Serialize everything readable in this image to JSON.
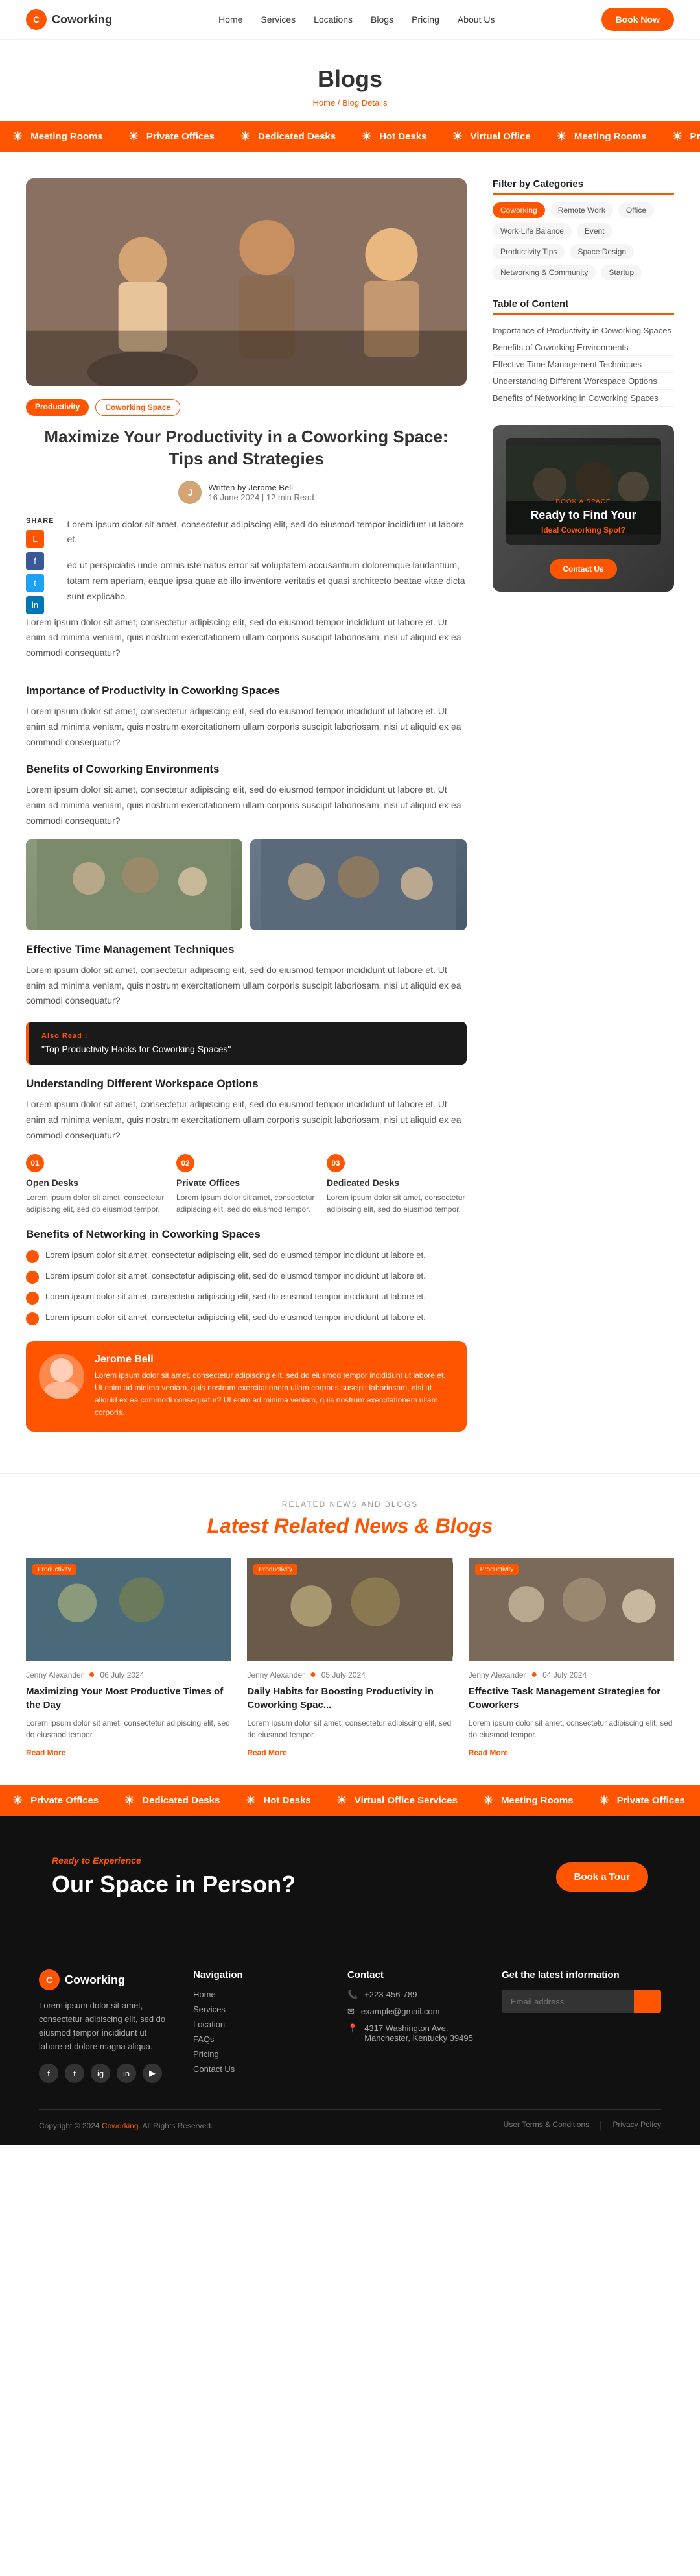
{
  "navbar": {
    "logo_text": "Coworking",
    "logo_icon": "C",
    "links": [
      "Home",
      "Services",
      "Locations",
      "Blogs",
      "Pricing",
      "About Us"
    ],
    "book_btn": "Book Now"
  },
  "page_header": {
    "title": "Blogs",
    "breadcrumb_home": "Home",
    "breadcrumb_sep": "/",
    "breadcrumb_current": "Blog Details"
  },
  "ticker": {
    "items": [
      "Meeting Rooms",
      "Private Offices",
      "Dedicated Desks",
      "Hot Desks",
      "Virtual Office",
      "Meeting Rooms",
      "Private Offices",
      "Dedicated Desks",
      "Hot Desks",
      "Virtual Office"
    ]
  },
  "article": {
    "tags": [
      "Productivity",
      "Coworking Space"
    ],
    "title": "Maximize Your Productivity in a Coworking Space: Tips and Strategies",
    "author_name": "Jerome Bell",
    "meta": "16 June 2024 | 12 min Read",
    "intro": "Lorem ipsum dolor sit amet, consectetur adipiscing elit, sed do eiusmod tempor incididunt ut labore et.",
    "intro_p2": "ed ut perspiciatis unde omnis iste natus error sit voluptatem accusantium doloremque laudantium, totam rem aperiam, eaque ipsa quae ab illo inventore veritatis et quasi architecto beatae vitae dicta sunt explicabo.",
    "intro_p3": "Lorem ipsum dolor sit amet, consectetur adipiscing elit, sed do eiusmod tempor incididunt ut labore et. Ut enim ad minima veniam, quis nostrum exercitationem ullam corporis suscipit laboriosam, nisi ut aliquid ex ea commodi consequatur?",
    "section1_title": "Importance of Productivity in Coworking Spaces",
    "section1_text": "Lorem ipsum dolor sit amet, consectetur adipiscing elit, sed do eiusmod tempor incididunt ut labore et. Ut enim ad minima veniam, quis nostrum exercitationem ullam corporis suscipit laboriosam, nisi ut aliquid ex ea commodi consequatur?",
    "section2_title": "Benefits of Coworking Environments",
    "section2_text": "Lorem ipsum dolor sit amet, consectetur adipiscing elit, sed do eiusmod tempor incididunt ut labore et. Ut enim ad minima veniam, quis nostrum exercitationem ullam corporis suscipit laboriosam, nisi ut aliquid ex ea commodi consequatur?",
    "section3_title": "Effective Time Management Techniques",
    "section3_text": "Lorem ipsum dolor sit amet, consectetur adipiscing elit, sed do eiusmod tempor incididunt ut labore et. Ut enim ad minima veniam, quis nostrum exercitationem ullam corporis suscipit laboriosam, nisi ut aliquid ex ea commodi consequatur?",
    "also_read_label": "Also Read :",
    "also_read_link": "\"Top Productivity Hacks for Coworking Spaces\"",
    "section4_title": "Understanding Different Workspace Options",
    "section4_text": "Lorem ipsum dolor sit amet, consectetur adipiscing elit, sed do eiusmod tempor incididunt ut labore et. Ut enim ad minima veniam, quis nostrum exercitationem ullam corporis suscipit laboriosam, nisi ut aliquid ex ea commodi consequatur?",
    "options": [
      {
        "num": "01",
        "title": "Open Desks",
        "text": "Lorem ipsum dolor sit amet, consectetur adipiscing elit, sed do eiusmod tempor."
      },
      {
        "num": "02",
        "title": "Private Offices",
        "text": "Lorem ipsum dolor sit amet, consectetur adipiscing elit, sed do eiusmod tempor."
      },
      {
        "num": "03",
        "title": "Dedicated Desks",
        "text": "Lorem ipsum dolor sit amet, consectetur adipiscing elit, sed do eiusmod tempor."
      }
    ],
    "section5_title": "Benefits of Networking in Coworking Spaces",
    "bullets": [
      "Lorem ipsum dolor sit amet, consectetur adipiscing elit, sed do eiusmod tempor incididunt ut labore et.",
      "Lorem ipsum dolor sit amet, consectetur adipiscing elit, sed do eiusmod tempor incididunt ut labore et.",
      "Lorem ipsum dolor sit amet, consectetur adipiscing elit, sed do eiusmod tempor incididunt ut labore et.",
      "Lorem ipsum dolor sit amet, consectetur adipiscing elit, sed do eiusmod tempor incididunt ut labore et."
    ],
    "bio_name": "Jerome Bell",
    "bio_text": "Lorem ipsum dolor sit amet, consectetur adipiscing elit, sed do eiusmod tempor incididunt ut labore et. Ut enim ad minima veniam, quis nostrum exercitationem ullam corporis suscipit laboriosam, nisi ut aliquid ex ea commodi consequatur? Ut enim ad minima veniam, quis nostrum exercitationem ullam corporis."
  },
  "sidebar": {
    "filter_title": "Filter by Categories",
    "filter_tags": [
      "Coworking",
      "Remote Work",
      "Office",
      "Work-Life Balance",
      "Event",
      "Productivity Tips",
      "Space Design",
      "Networking & Community",
      "Startup"
    ],
    "toc_title": "Table of Content",
    "toc_items": [
      "Importance of Productivity in Coworking Spaces",
      "Benefits of Coworking Environments",
      "Effective Time Management Techniques",
      "Understanding Different Workspace Options",
      "Benefits of Networking in Coworking Spaces"
    ],
    "cta_label": "BOOK A SPACE",
    "cta_title": "Ready to Find Your",
    "cta_subtitle": "Ideal Coworking Spot?",
    "cta_btn": "Contact Us"
  },
  "related": {
    "label": "RELATED NEWS AND BLOGS",
    "title_prefix": "Latest Related",
    "title_highlight": "News & Blogs",
    "cards": [
      {
        "badge": "Productivity",
        "author": "Jenny Alexander",
        "date": "06 July 2024",
        "title": "Maximizing Your Most Productive Times of the Day",
        "text": "Lorem ipsum dolor sit amet, consectetur adipiscing elit, sed do eiusmod tempor.",
        "read_more": "Read More"
      },
      {
        "badge": "Productivity",
        "author": "Jenny Alexander",
        "date": "05 July 2024",
        "title": "Daily Habits for Boosting Productivity in Coworking Spac...",
        "text": "Lorem ipsum dolor sit amet, consectetur adipiscing elit, sed do eiusmod tempor.",
        "read_more": "Read More"
      },
      {
        "badge": "Productivity",
        "author": "Jenny Alexander",
        "date": "04 July 2024",
        "title": "Effective Task Management Strategies for Coworkers",
        "text": "Lorem ipsum dolor sit amet, consectetur adipiscing elit, sed do eiusmod tempor.",
        "read_more": "Read More"
      }
    ]
  },
  "ready_cta": {
    "subtitle": "Ready to Experience",
    "title": "Our Space in Person?",
    "btn": "Book a Tour"
  },
  "footer": {
    "logo": "Coworking",
    "desc": "Lorem ipsum dolor sit amet, consectetur adipiscing elit, sed do eiusmod tempor incididunt ut labore et dolore magna aliqua.",
    "nav_title": "Navigation",
    "nav_links": [
      "Home",
      "Services",
      "Location",
      "FAQs",
      "Pricing",
      "Contact Us"
    ],
    "contact_title": "Contact",
    "phone": "+223-456-789",
    "email": "example@gmail.com",
    "address": "4317 Washington Ave. Manchester, Kentucky 39495",
    "newsletter_title": "Get the latest information",
    "newsletter_placeholder": "Email address",
    "newsletter_btn": "→",
    "copy": "Copyright © 2024 Coworking. All Rights Reserved.",
    "links": [
      "User Terms & Conditions",
      "Privacy Policy"
    ]
  }
}
